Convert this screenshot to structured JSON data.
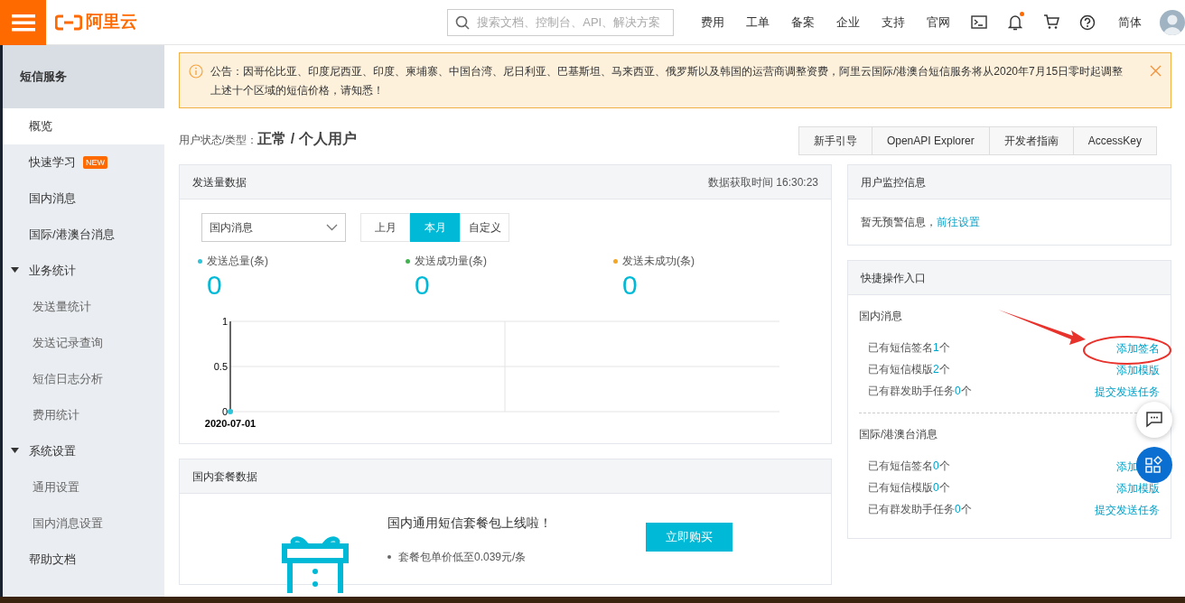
{
  "header": {
    "logo": "阿里云",
    "search": {
      "placeholder": "搜索文档、控制台、API、解决方案"
    },
    "nav": [
      "费用",
      "工单",
      "备案",
      "企业",
      "支持",
      "官网"
    ],
    "notification_dot": true,
    "language": "简体"
  },
  "sidebar": {
    "title": "短信服务",
    "items": [
      {
        "label": "概览",
        "selected": true
      },
      {
        "label": "快速学习",
        "selected": false,
        "badge": "NEW"
      },
      {
        "label": "国内消息",
        "selected": false
      },
      {
        "label": "国际/港澳台消息",
        "selected": false
      },
      {
        "label": "业务统计",
        "selected": false,
        "expanded": true,
        "children": [
          {
            "label": "发送量统计",
            "selected": false
          },
          {
            "label": "发送记录查询",
            "selected": false
          },
          {
            "label": "短信日志分析",
            "selected": false
          },
          {
            "label": "费用统计",
            "selected": false
          }
        ]
      },
      {
        "label": "系统设置",
        "selected": false,
        "expanded": true,
        "children": [
          {
            "label": "通用设置",
            "selected": false
          },
          {
            "label": "国内消息设置",
            "selected": false
          }
        ]
      },
      {
        "label": "帮助文档",
        "selected": false
      }
    ]
  },
  "notice": "公告：因哥伦比亚、印度尼西亚、印度、柬埔寨、中国台湾、尼日利亚、巴基斯坦、马来西亚、俄罗斯以及韩国的运营商调整资费，阿里云国际/港澳台短信服务将从2020年7月15日零时起调整上述十个区域的短信价格，请知悉！",
  "user_status": {
    "label": "用户状态/类型：",
    "value": "正常 / 个人用户"
  },
  "top_buttons": [
    "新手引导",
    "OpenAPI Explorer",
    "开发者指南",
    "AccessKey"
  ],
  "send_panel": {
    "title": "发送量数据",
    "fetch_time": "数据获取时间 16:30:23",
    "select": "国内消息",
    "periods": [
      {
        "label": "上月",
        "selected": false
      },
      {
        "label": "本月",
        "selected": true
      },
      {
        "label": "自定义",
        "selected": false
      }
    ],
    "stats": [
      {
        "label": "发送总量(条)",
        "value": "0",
        "color": "#2ec4d9"
      },
      {
        "label": "发送成功量(条)",
        "value": "0",
        "color": "#3eb34f"
      },
      {
        "label": "发送未成功(条)",
        "value": "0",
        "color": "#f5a623"
      }
    ],
    "chart_data": {
      "type": "line",
      "categories": [
        "2020-07-01"
      ],
      "ylim": [
        0,
        1
      ],
      "yticks": [
        0,
        0.5,
        1
      ],
      "series": [
        {
          "color": "#2ec4d9",
          "marker": "circle",
          "values": [
            0
          ]
        }
      ]
    }
  },
  "package_panel": {
    "title": "国内套餐数据",
    "headline": "国内通用短信套餐包上线啦！",
    "bullets": [
      "套餐包单价低至0.039元/条"
    ],
    "button": "立即购买"
  },
  "monitor_panel": {
    "title": "用户监控信息",
    "text": "暂无预警信息，",
    "link": "前往设置"
  },
  "quick_panel": {
    "title": "快捷操作入口",
    "sections": [
      {
        "title": "国内消息",
        "rows": [
          {
            "text": "已有短信签名",
            "count": "1",
            "unit": "个",
            "action": "添加签名"
          },
          {
            "text": "已有短信模版",
            "count": "2",
            "unit": "个",
            "action": "添加模版"
          },
          {
            "text": "已有群发助手任务",
            "count": "0",
            "unit": "个",
            "action": "提交发送任务"
          }
        ]
      },
      {
        "title": "国际/港澳台消息",
        "rows": [
          {
            "text": "已有短信签名",
            "count": "0",
            "unit": "个",
            "action": "添加"
          },
          {
            "text": "已有短信模版",
            "count": "0",
            "unit": "个",
            "action": "添加模版"
          },
          {
            "text": "已有群发助手任务",
            "count": "0",
            "unit": "个",
            "action": "提交发送任务"
          }
        ]
      }
    ]
  }
}
